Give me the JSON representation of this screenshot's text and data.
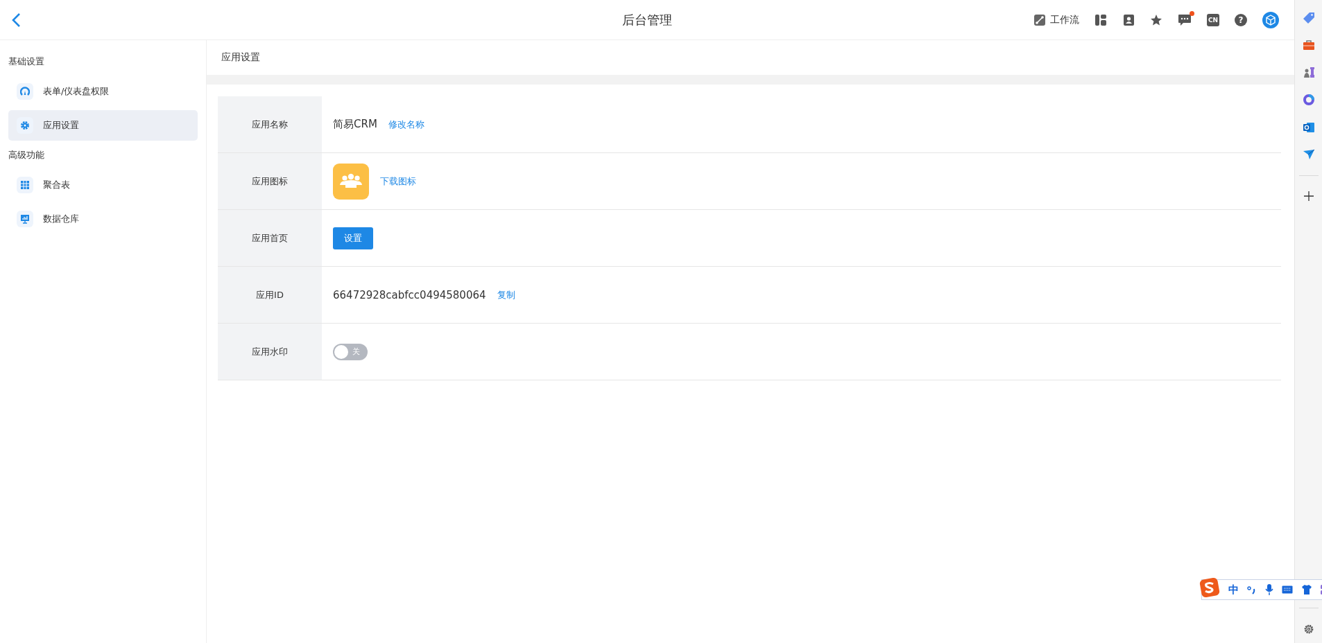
{
  "header": {
    "title": "后台管理",
    "workflow": {
      "label": "工作流"
    },
    "icons": [
      {
        "kind": "layout"
      },
      {
        "kind": "contacts"
      },
      {
        "kind": "star"
      },
      {
        "kind": "chat",
        "dot": true
      },
      {
        "kind": "lang",
        "label": "CN"
      },
      {
        "kind": "help",
        "label": "?"
      },
      {
        "kind": "avatar"
      }
    ]
  },
  "sidebar": {
    "groups": [
      {
        "title": "基础设置",
        "items": [
          {
            "label": "表单/仪表盘权限",
            "selected": false
          },
          {
            "label": "应用设置",
            "selected": true
          }
        ]
      },
      {
        "title": "高级功能",
        "items": [
          {
            "label": "聚合表",
            "selected": false
          },
          {
            "label": "数据仓库",
            "selected": false
          }
        ]
      }
    ]
  },
  "content": {
    "title": "应用设置",
    "rows": [
      {
        "kind": "name",
        "label": "应用名称",
        "value": "简易CRM",
        "link": "修改名称"
      },
      {
        "kind": "icon",
        "label": "应用图标",
        "link": "下载图标"
      },
      {
        "kind": "button",
        "label": "应用首页",
        "button": "设置"
      },
      {
        "kind": "id",
        "label": "应用ID",
        "value": "66472928cabfcc0494580064",
        "link": "复制"
      },
      {
        "kind": "toggle",
        "label": "应用水印",
        "on": false,
        "state_label": "关"
      }
    ]
  },
  "ime": {
    "label": "中"
  }
}
